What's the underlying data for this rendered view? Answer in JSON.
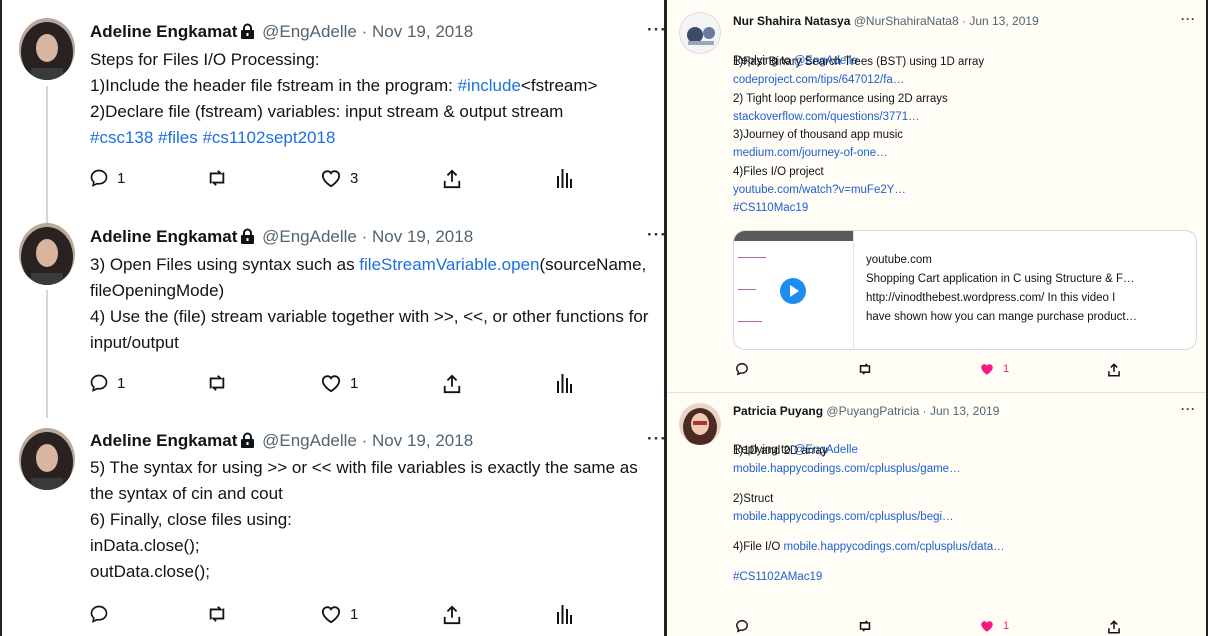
{
  "left_thread": {
    "tweets": [
      {
        "name": "Adeline Engkamat",
        "handle": "@EngAdelle",
        "dot": "·",
        "date": "Nov 19, 2018",
        "more": "···",
        "lines": [
          [
            {
              "t": "Steps for Files I/O Processing:"
            }
          ],
          [
            {
              "t": "1)Include the header file fstream in the program: "
            },
            {
              "t": "#include",
              "link": true
            },
            {
              "t": "<fstream>"
            }
          ],
          [
            {
              "t": "2)Declare file (fstream) variables: input stream & output stream"
            }
          ],
          [
            {
              "t": "#csc138 #files #cs1102sept2018",
              "link": true
            }
          ]
        ],
        "reply_count": "1",
        "retweet_count": "",
        "like_count": "3"
      },
      {
        "name": "Adeline Engkamat",
        "handle": "@EngAdelle",
        "dot": "·",
        "date": "Nov 19, 2018",
        "more": "···",
        "lines": [
          [
            {
              "t": "3) Open Files using syntax such as "
            },
            {
              "t": "fileStreamVariable.open",
              "link": true
            },
            {
              "t": "(sourceName,"
            }
          ],
          [
            {
              "t": "fileOpeningMode)"
            }
          ],
          [
            {
              "t": "4) Use the (file) stream variable together with >>, <<, or other functions for"
            }
          ],
          [
            {
              "t": "input/output"
            }
          ]
        ],
        "reply_count": "1",
        "retweet_count": "",
        "like_count": "1"
      },
      {
        "name": "Adeline Engkamat",
        "handle": "@EngAdelle",
        "dot": "·",
        "date": "Nov 19, 2018",
        "more": "···",
        "lines": [
          [
            {
              "t": "5) The syntax for using >> or << with file variables is exactly the same as"
            }
          ],
          [
            {
              "t": "the syntax of cin and cout"
            }
          ],
          [
            {
              "t": "6) Finally, close files using:"
            }
          ],
          [
            {
              "t": "inData.close();"
            }
          ],
          [
            {
              "t": "outData.close();"
            }
          ]
        ],
        "reply_count": "",
        "retweet_count": "",
        "like_count": "1"
      }
    ]
  },
  "right_replies": {
    "tweets": [
      {
        "name": "Nur Shahira Natasya",
        "handle": "@NurShahiraNata8",
        "dot": "·",
        "date": "Jun 13, 2019",
        "more": "···",
        "replying_prefix": "Replying to ",
        "replying_to": "@EngAdelle",
        "lines": [
          [
            {
              "t": "1)Fast Binary Search Trees (BST) using 1D array"
            }
          ],
          [
            {
              "t": "codeproject.com/tips/647012/fa…",
              "link": true
            }
          ],
          [
            {
              "t": "2) Tight loop performance using 2D arrays"
            }
          ],
          [
            {
              "t": "stackoverflow.com/questions/3771…",
              "link": true
            }
          ],
          [
            {
              "t": "3)Journey of thousand app music"
            }
          ],
          [
            {
              "t": "medium.com/journey-of-one…",
              "link": true
            }
          ],
          [
            {
              "t": "4)Files I/O project"
            }
          ],
          [
            {
              "t": "youtube.com/watch?v=muFe2Y…",
              "link": true
            }
          ],
          [
            {
              "t": "#CS110Mac19",
              "link": true
            }
          ]
        ],
        "card": {
          "domain": "youtube.com",
          "title": "Shopping Cart application in C using Structure & F…",
          "desc_line1": "http://vinodthebest.wordpress.com/ In this video I",
          "desc_line2": "have shown how you can mange purchase product…"
        },
        "reply_count": "",
        "retweet_count": "",
        "like_count": "1",
        "liked": true
      },
      {
        "name": "Patricia Puyang",
        "handle": "@PuyangPatricia",
        "dot": "·",
        "date": "Jun 13, 2019",
        "more": "···",
        "replying_prefix": "Replying to ",
        "replying_to": "@EngAdelle",
        "lines": [
          [
            {
              "t": "1)1D and 2D array"
            }
          ],
          [
            {
              "t": "mobile.happycodings.com/cplusplus/game…",
              "link": true
            }
          ],
          [
            {
              "t": ""
            }
          ],
          [
            {
              "t": "2)Struct"
            }
          ],
          [
            {
              "t": "mobile.happycodings.com/cplusplus/begi…",
              "link": true
            }
          ],
          [
            {
              "t": ""
            }
          ],
          [
            {
              "t": "4)File I/O "
            },
            {
              "t": "mobile.happycodings.com/cplusplus/data…",
              "link": true
            }
          ],
          [
            {
              "t": ""
            }
          ],
          [
            {
              "t": "#CS1102AMac19",
              "link": true
            }
          ]
        ],
        "reply_count": "",
        "retweet_count": "",
        "like_count": "1",
        "liked": true
      }
    ]
  },
  "colors": {
    "link": "#1d6fe0",
    "like_active": "#f91880",
    "icon_gray": "#536471"
  },
  "icons": [
    "reply-icon",
    "retweet-icon",
    "like-icon",
    "share-icon",
    "analytics-icon",
    "lock-icon",
    "more-icon",
    "play-icon"
  ]
}
